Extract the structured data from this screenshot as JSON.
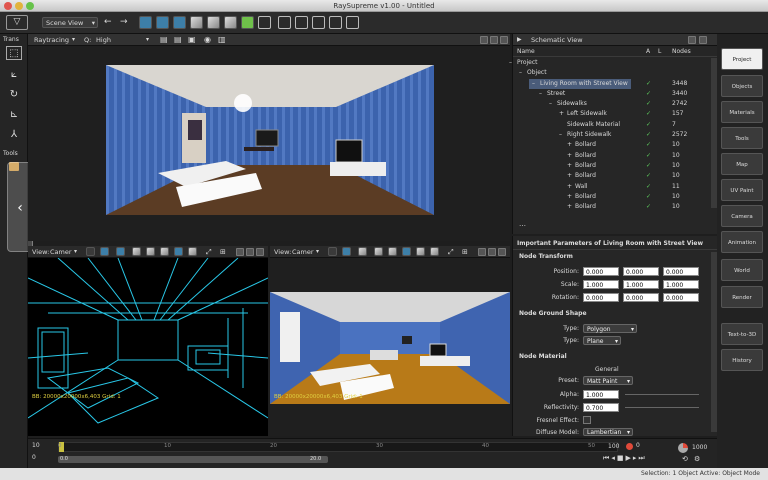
{
  "window": {
    "title": "RaySupreme v1.00 - Untitled"
  },
  "toolbar": {
    "view_select": "Scene View"
  },
  "leftbar": {
    "trans_label": "Trans",
    "tools_label": "Tools"
  },
  "main_viewport": {
    "render_mode": "Raytracing",
    "quality_label": "Q:",
    "quality_value": "High"
  },
  "wire_viewport": {
    "view_label": "View:",
    "view_value": "Camer",
    "hud": "BB: 20000x20000x6,403  Grid: 1"
  },
  "shaded_viewport": {
    "view_label": "View:",
    "view_value": "Camer",
    "hud": "BB: 20000x20000x6,403  Grid: 1"
  },
  "schematic": {
    "title": "Schematic View",
    "columns": {
      "name": "Name",
      "a": "A",
      "l": "L",
      "nodes": "Nodes"
    },
    "rows": [
      {
        "prefix": "–",
        "name": "Project",
        "a": "",
        "nodes": ""
      },
      {
        "prefix": "–",
        "name": "Object",
        "a": "",
        "nodes": ""
      },
      {
        "prefix": "–",
        "name": "Living Room with Street View",
        "a": "✓",
        "nodes": "3448"
      },
      {
        "prefix": "–",
        "name": "Street",
        "a": "✓",
        "nodes": "3440"
      },
      {
        "prefix": "–",
        "name": "Sidewalks",
        "a": "✓",
        "nodes": "2742"
      },
      {
        "prefix": "+",
        "name": "Left Sidewalk",
        "a": "✓",
        "nodes": "157"
      },
      {
        "prefix": "",
        "name": "Sidewalk Material",
        "a": "✓",
        "nodes": "7"
      },
      {
        "prefix": "–",
        "name": "Right Sidewalk",
        "a": "✓",
        "nodes": "2572"
      },
      {
        "prefix": "+",
        "name": "Bollard",
        "a": "✓",
        "nodes": "10"
      },
      {
        "prefix": "+",
        "name": "Bollard",
        "a": "✓",
        "nodes": "10"
      },
      {
        "prefix": "+",
        "name": "Bollard",
        "a": "✓",
        "nodes": "10"
      },
      {
        "prefix": "+",
        "name": "Bollard",
        "a": "✓",
        "nodes": "10"
      },
      {
        "prefix": "+",
        "name": "Wall",
        "a": "✓",
        "nodes": "11"
      },
      {
        "prefix": "+",
        "name": "Bollard",
        "a": "✓",
        "nodes": "10"
      },
      {
        "prefix": "+",
        "name": "Bollard",
        "a": "✓",
        "nodes": "10"
      }
    ],
    "ellipsis": "…"
  },
  "params": {
    "title": "Important Parameters of Living Room with Street View",
    "node_transform": "Node Transform",
    "position_label": "Position:",
    "position": [
      "0.000",
      "0.000",
      "0.000"
    ],
    "scale_label": "Scale:",
    "scale": [
      "1.000",
      "1.000",
      "1.000"
    ],
    "rotation_label": "Rotation:",
    "rotation": [
      "0.000",
      "0.000",
      "0.000"
    ],
    "ground_shape": "Node Ground Shape",
    "type_label": "Type:",
    "type1": "Polygon",
    "type2": "Plane",
    "node_material": "Node Material",
    "general": "General",
    "preset_label": "Preset:",
    "preset": "Matt Paint",
    "alpha_label": "Alpha:",
    "alpha": "1.000",
    "reflectivity_label": "Reflectivity:",
    "reflectivity": "0.700",
    "fresnel_label": "Fresnel Effect:",
    "diffuse_label": "Diffuse Model:",
    "diffuse": "Lambertian"
  },
  "rightbar": [
    "Project",
    "Objects",
    "Materials",
    "Tools",
    "Map",
    "UV Paint",
    "Camera",
    "Animation",
    "World",
    "Render",
    "Text-to-3D",
    "History"
  ],
  "timeline": {
    "ruler": [
      "0",
      "10",
      "20",
      "30",
      "40",
      "50"
    ],
    "rows": [
      "10",
      "0"
    ],
    "range_start": "0.0",
    "range_end": "20.0",
    "current_frame": "0",
    "fps": "100",
    "end_frame": "1000"
  },
  "status": {
    "text": "Selection: 1 Object Active: Object Mode"
  },
  "colors": {
    "accent": "#3d7fa8",
    "wire": "#29c8e8",
    "hud": "#e0d040",
    "check": "#5fd05f"
  }
}
